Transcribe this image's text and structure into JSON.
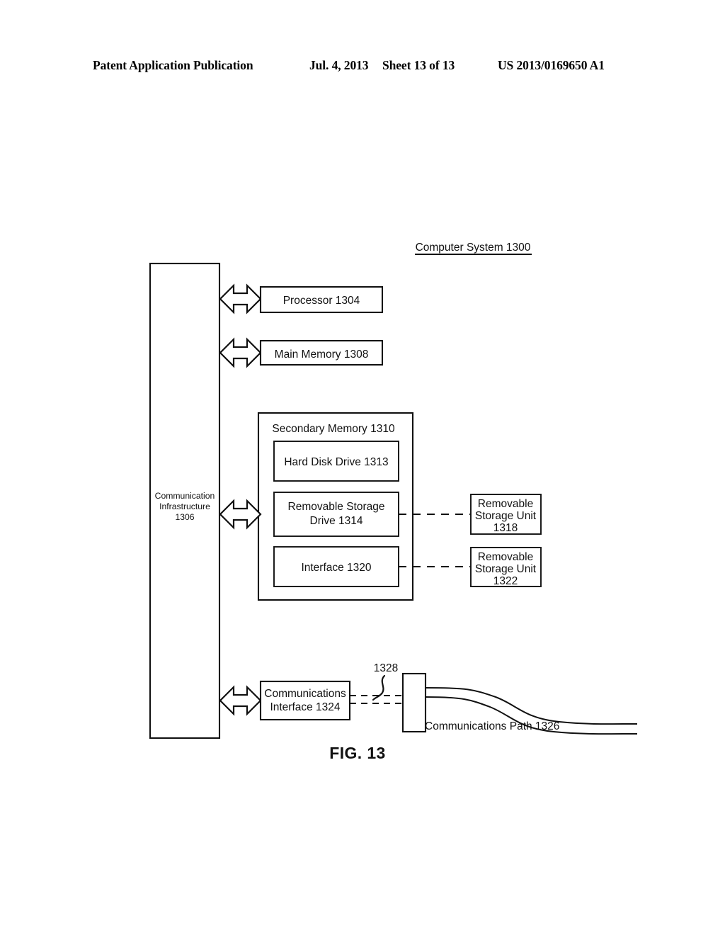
{
  "header": {
    "publication": "Patent Application Publication",
    "date": "Jul. 4, 2013",
    "sheet": "Sheet 13 of 13",
    "patent_number": "US 2013/0169650 A1"
  },
  "figure": {
    "caption": "FIG. 13",
    "title": "Computer System 1300",
    "blocks": {
      "bus": {
        "line1": "Communication",
        "line2": "Infrastructure",
        "line3": "1306"
      },
      "processor": "Processor 1304",
      "main_memory": "Main Memory 1308",
      "secondary_memory": "Secondary Memory 1310",
      "hard_disk_drive": "Hard Disk Drive 1313",
      "removable_storage_drive": {
        "line1": "Removable Storage",
        "line2": "Drive 1314"
      },
      "interface": "Interface 1320",
      "removable_storage_unit_1318": {
        "line1": "Removable",
        "line2": "Storage Unit",
        "line3": "1318"
      },
      "removable_storage_unit_1322": {
        "line1": "Removable",
        "line2": "Storage Unit",
        "line3": "1322"
      },
      "communications_interface": {
        "line1": "Communications",
        "line2": "Interface 1324"
      },
      "communications_path": "Communications Path 1326",
      "signal_callout": "1328"
    }
  },
  "colors": {
    "ink": "#111111",
    "paper": "#ffffff"
  }
}
